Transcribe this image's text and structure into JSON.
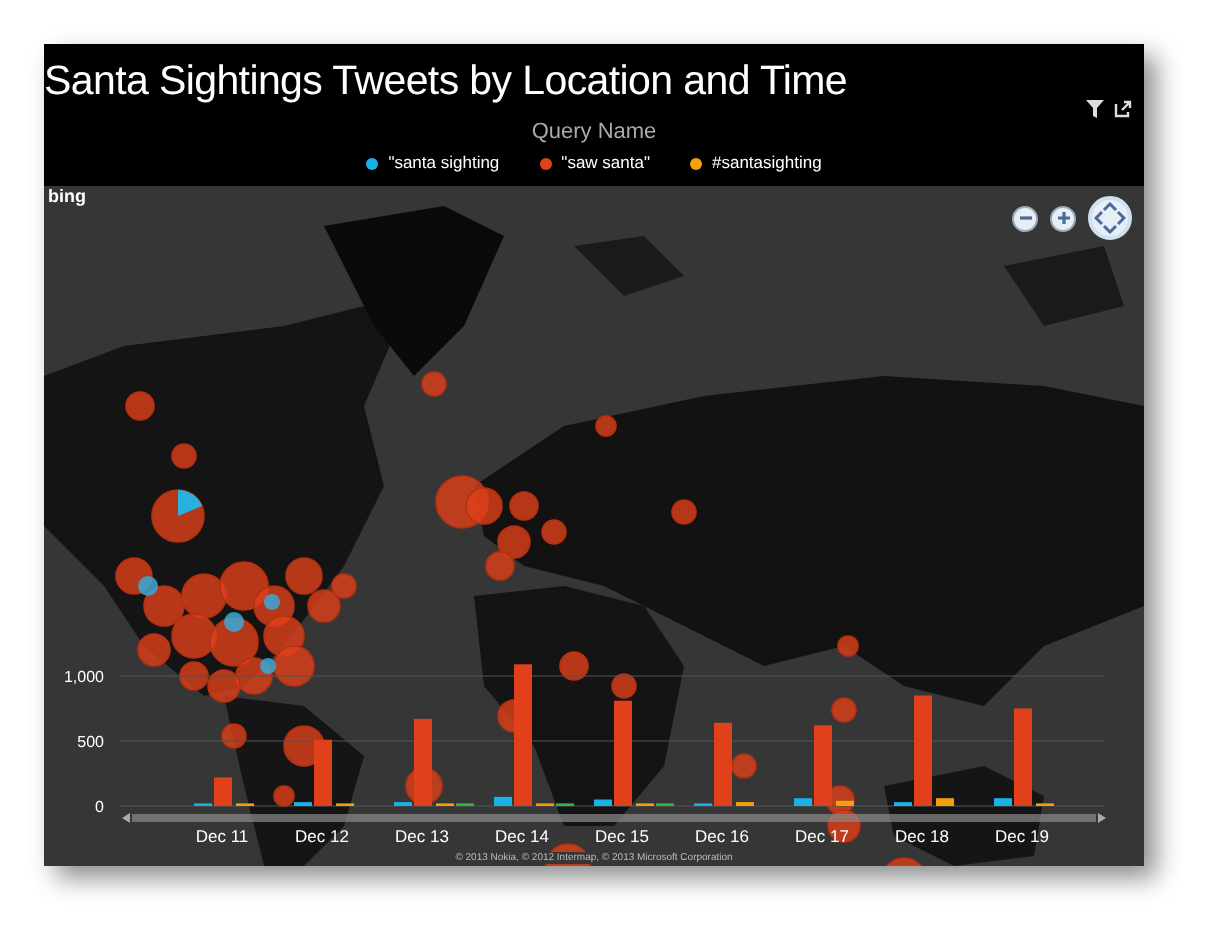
{
  "title": "Santa Sightings Tweets by Location and Time",
  "legend": {
    "title": "Query Name"
  },
  "map": {
    "kind": "picture",
    "logo": "bing",
    "attribution": "© 2013 Nokia, © 2012 Intermap, © 2013 Microsoft Corporation"
  },
  "chart": {
    "chart_data": {
      "type": "bar",
      "categories": [
        "Dec 11",
        "Dec 12",
        "Dec 13",
        "Dec 14",
        "Dec 15",
        "Dec 16",
        "Dec 17",
        "Dec 18",
        "Dec 19"
      ],
      "series": [
        {
          "name": "\"santa sighting",
          "color": "#1ab0e8",
          "values": [
            20,
            30,
            30,
            70,
            50,
            20,
            60,
            30,
            60
          ]
        },
        {
          "name": "\"saw santa\"",
          "color": "#e0401a",
          "values": [
            220,
            510,
            670,
            1090,
            810,
            640,
            620,
            850,
            750
          ]
        },
        {
          "name": "#santasighting",
          "color": "#f5a00a",
          "values": [
            20,
            20,
            20,
            20,
            20,
            30,
            40,
            60,
            20
          ]
        },
        {
          "color": "#2eb84a",
          "values": [
            null,
            null,
            20,
            20,
            20,
            null,
            null,
            null,
            null
          ]
        }
      ],
      "ylim": [
        0,
        1100
      ],
      "yticks": [
        0,
        500,
        {
          "value": 1000,
          "label": "1,000"
        }
      ]
    }
  }
}
